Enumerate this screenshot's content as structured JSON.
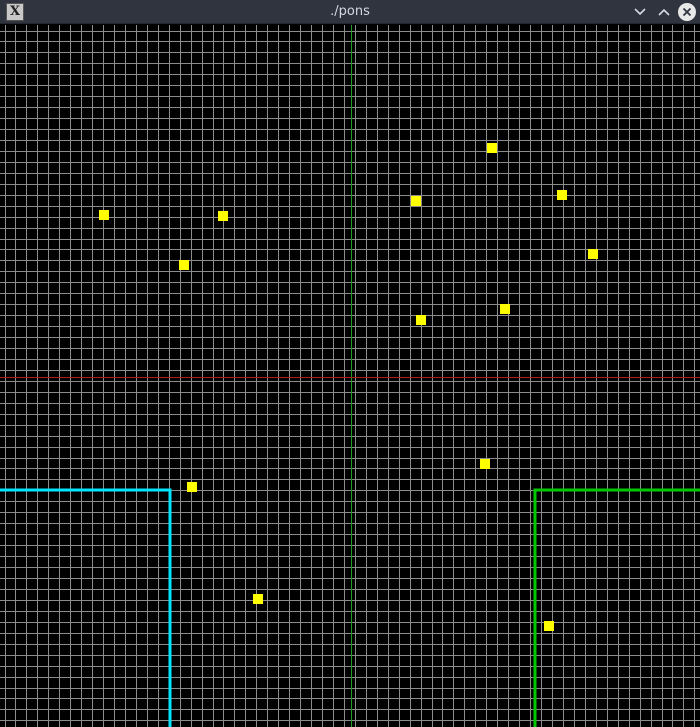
{
  "window": {
    "title": "./pons",
    "app_icon_glyph": "X",
    "controls": [
      "minimize-icon",
      "maximize-icon",
      "close-icon"
    ]
  },
  "plot": {
    "background_color": "#000000",
    "grid_color": "#8c8c8c",
    "vertical_axis_color": "#1e9e1e",
    "horizontal_axis_color": "#b01a1a",
    "point_color": "#ffff00",
    "cyan_region_color": "#00e5ff",
    "green_region_color": "#00c800"
  }
}
